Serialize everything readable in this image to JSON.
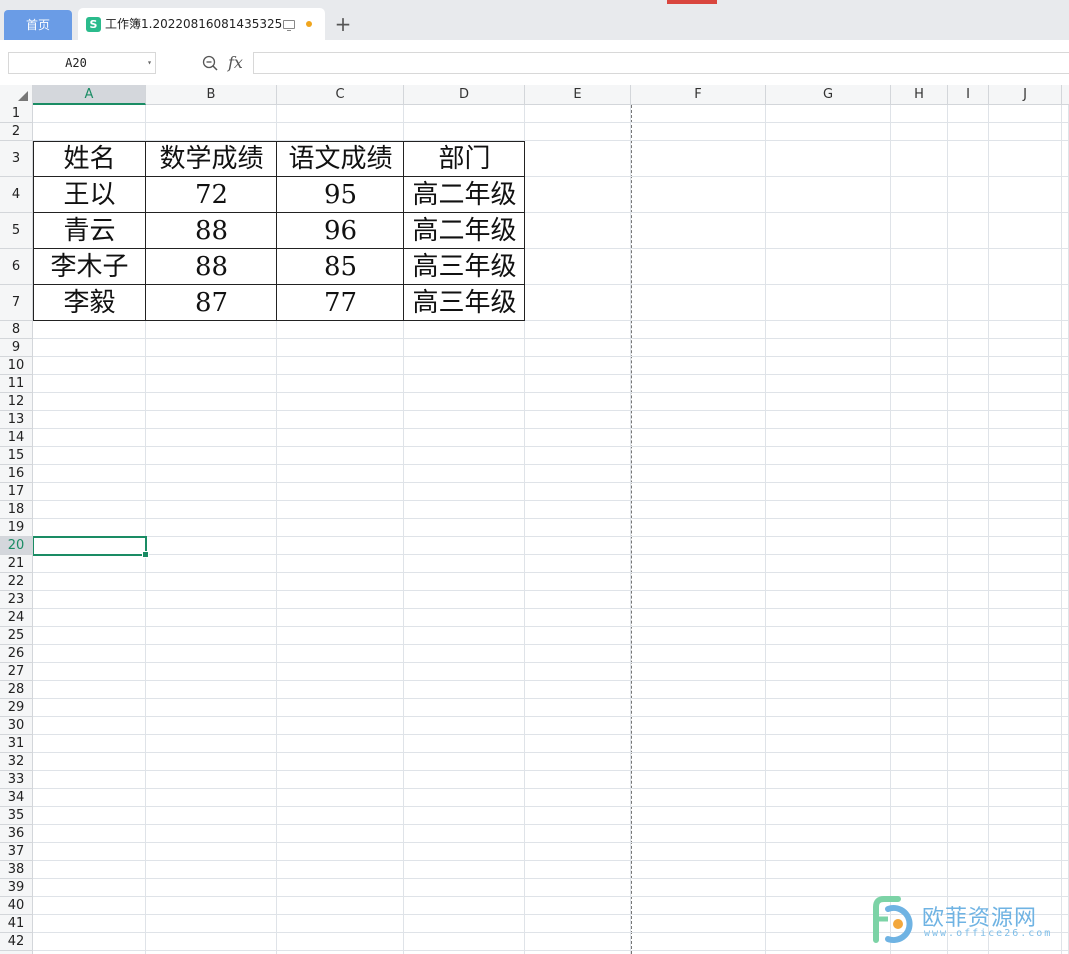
{
  "tabs": {
    "home_label": "首页",
    "doc_icon_glyph": "S",
    "doc_title": "工作簿1.20220816081435325",
    "new_tab_glyph": "+"
  },
  "formula_bar": {
    "name_box_value": "A20",
    "name_box_arrow": "▾",
    "fx_label": "fx",
    "formula_value": ""
  },
  "columns": [
    "A",
    "B",
    "C",
    "D",
    "E",
    "F",
    "G",
    "H",
    "I",
    "J"
  ],
  "active_column": "A",
  "active_row": 20,
  "selected_cell": "A20",
  "rows": [
    "1",
    "2",
    "3",
    "4",
    "5",
    "6",
    "7",
    "8",
    "9",
    "10",
    "11",
    "12",
    "13",
    "14",
    "15",
    "16",
    "17",
    "18",
    "19",
    "20",
    "21",
    "22",
    "23",
    "24",
    "25",
    "26",
    "27",
    "28",
    "29",
    "30",
    "31",
    "32",
    "33",
    "34",
    "35",
    "36",
    "37",
    "38",
    "39",
    "40",
    "41",
    "42"
  ],
  "table": {
    "header": [
      "姓名",
      "数学成绩",
      "语文成绩",
      "部门"
    ],
    "body": [
      [
        "王以",
        "72",
        "95",
        "高二年级"
      ],
      [
        "青云",
        "88",
        "96",
        "高二年级"
      ],
      [
        "李木子",
        "88",
        "85",
        "高三年级"
      ],
      [
        "李毅",
        "87",
        "77",
        "高三年级"
      ]
    ]
  },
  "watermark": {
    "main_text": "欧菲资源网",
    "sub_text": "www.office26.com",
    "colors": {
      "blue": "#6fb3e3",
      "green": "#7cd3a6",
      "orange": "#f3a73b"
    }
  },
  "colors": {
    "accent_green": "#1a8c64",
    "home_tab": "#6a9ce6",
    "unsaved_dot": "#f0a51d"
  }
}
